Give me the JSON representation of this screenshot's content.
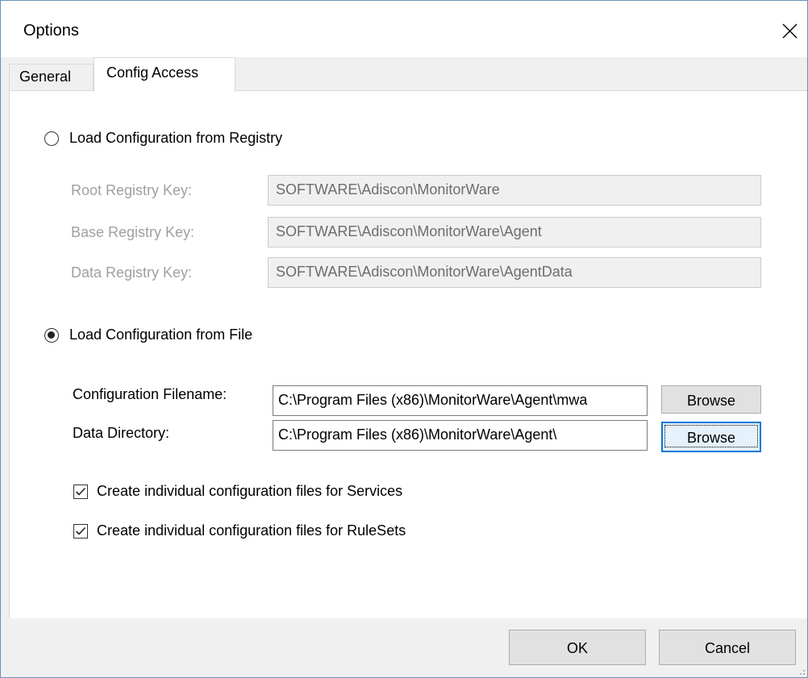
{
  "window": {
    "title": "Options",
    "close_icon": "close-icon"
  },
  "tabs": [
    {
      "label": "General",
      "selected": false
    },
    {
      "label": "Config Access",
      "selected": true
    }
  ],
  "registry": {
    "radio_label": "Load Configuration from Registry",
    "selected": false,
    "root_label": "Root Registry Key:",
    "root_value": "SOFTWARE\\Adiscon\\MonitorWare",
    "base_label": "Base Registry Key:",
    "base_value": "SOFTWARE\\Adiscon\\MonitorWare\\Agent",
    "data_label": "Data Registry Key:",
    "data_value": "SOFTWARE\\Adiscon\\MonitorWare\\AgentData"
  },
  "file": {
    "radio_label": "Load Configuration from File",
    "selected": true,
    "config_label": "Configuration Filename:",
    "config_value": "C:\\Program Files (x86)\\MonitorWare\\Agent\\mwa",
    "config_browse": "Browse",
    "dir_label": "Data Directory:",
    "dir_value": "C:\\Program Files (x86)\\MonitorWare\\Agent\\",
    "dir_browse": "Browse"
  },
  "options": [
    {
      "label": "Create individual configuration files for Services",
      "checked": true
    },
    {
      "label": "Create individual configuration files for RuleSets",
      "checked": true
    }
  ],
  "footer": {
    "ok": "OK",
    "cancel": "Cancel"
  },
  "colors": {
    "focus_border": "#0078d7",
    "disabled_text": "#a0a0a0"
  }
}
